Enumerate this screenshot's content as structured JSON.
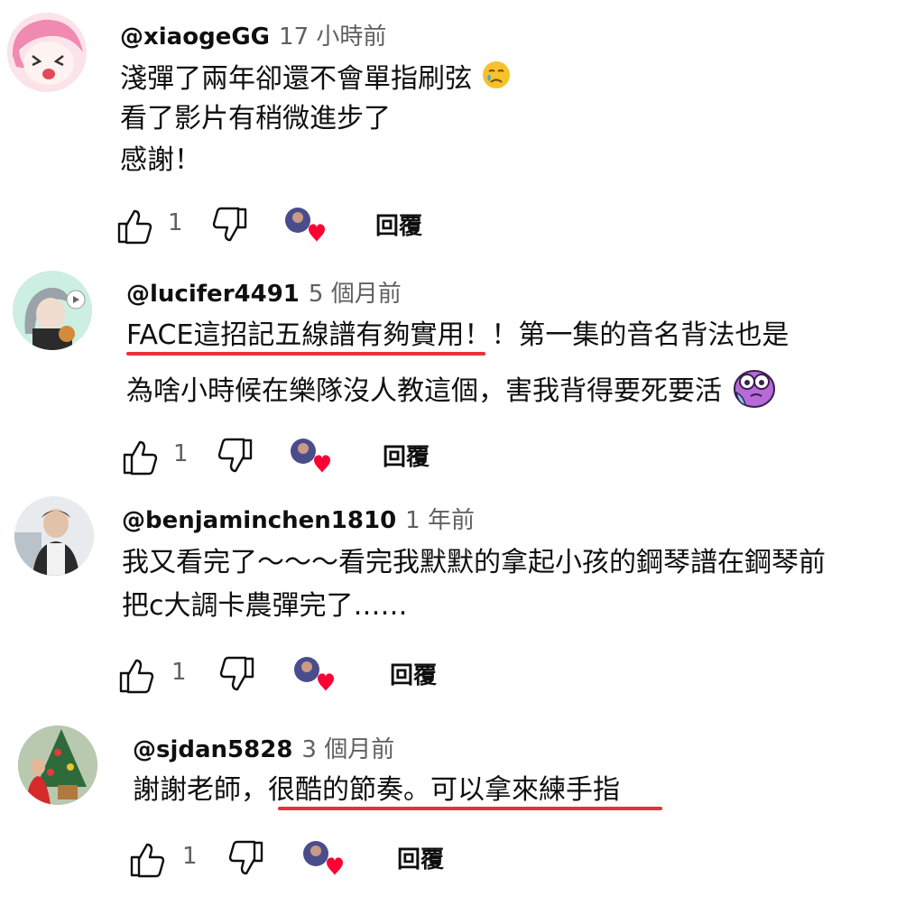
{
  "comments": [
    {
      "handle": "@xiaogeGG",
      "time": "17 小時前",
      "lines": [
        "淺彈了兩年卻還不會單指刷弦",
        "看了影片有稍微進步了",
        "感謝！"
      ],
      "emoji": "crying-face",
      "likes": "1",
      "reply": "回覆"
    },
    {
      "handle": "@lucifer4491",
      "time": "5 個月前",
      "lines": [
        "FACE這招記五線譜有夠實用！！第一集的音名背法也是",
        "為啥小時候在樂隊沒人教這個，害我背得要死要活"
      ],
      "emoji": "pleading-purple-face",
      "likes": "1",
      "reply": "回覆"
    },
    {
      "handle": "@benjaminchen1810",
      "time": "1 年前",
      "lines": [
        "我又看完了～～～看完我默默的拿起小孩的鋼琴譜在鋼琴前",
        "把c大調卡農彈完了……"
      ],
      "likes": "1",
      "reply": "回覆"
    },
    {
      "handle": "@sjdan5828",
      "time": "3 個月前",
      "lines": [
        "謝謝老師，很酷的節奏。可以拿來練手指"
      ],
      "likes": "1",
      "reply": "回覆"
    }
  ],
  "colors": {
    "underline": "#e8313a",
    "heart": "#ff0033",
    "meta": "#606060"
  }
}
